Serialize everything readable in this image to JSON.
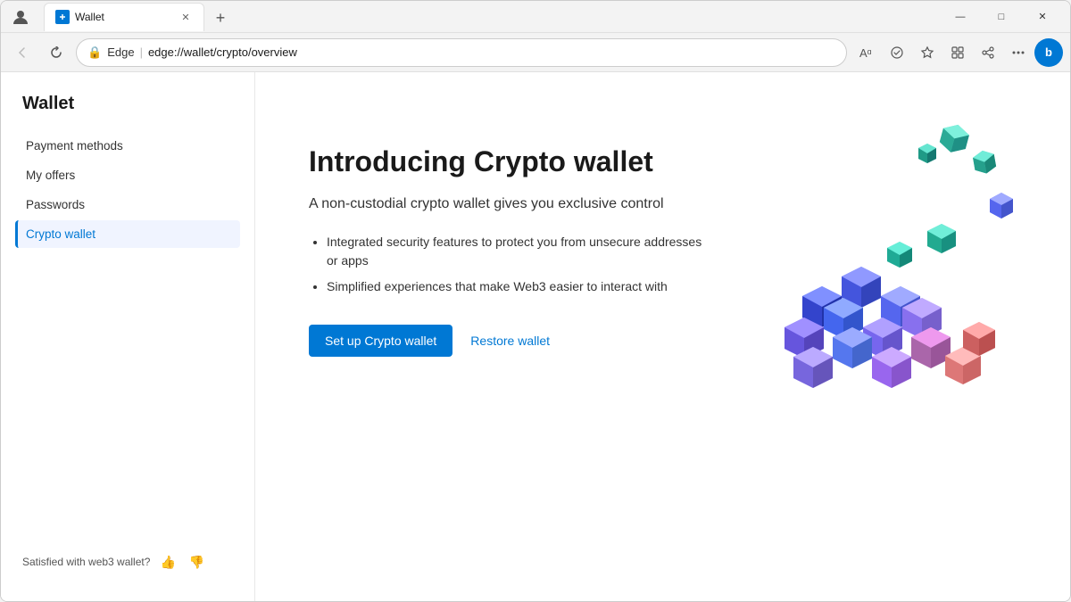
{
  "browser": {
    "title": "Wallet",
    "tab_label": "Wallet",
    "url": "edge://wallet/crypto/overview",
    "edge_label": "Edge",
    "url_display": "edge://wallet/crypto/overview"
  },
  "window_controls": {
    "minimize": "—",
    "maximize": "□",
    "close": "✕"
  },
  "toolbar": {
    "back": "←",
    "refresh": "↺"
  },
  "sidebar": {
    "title": "Wallet",
    "items": [
      {
        "id": "payment-methods",
        "label": "Payment methods",
        "active": false
      },
      {
        "id": "my-offers",
        "label": "My offers",
        "active": false
      },
      {
        "id": "passwords",
        "label": "Passwords",
        "active": false
      },
      {
        "id": "crypto-wallet",
        "label": "Crypto wallet",
        "active": true
      }
    ],
    "feedback_label": "Satisfied with web3 wallet?"
  },
  "main": {
    "intro_title": "Introducing Crypto wallet",
    "intro_subtitle": "A non-custodial crypto wallet gives you exclusive control",
    "features": [
      "Integrated security features to protect you from unsecure addresses or apps",
      "Simplified experiences that make Web3 easier to interact with"
    ],
    "setup_button": "Set up Crypto wallet",
    "restore_button": "Restore wallet"
  }
}
